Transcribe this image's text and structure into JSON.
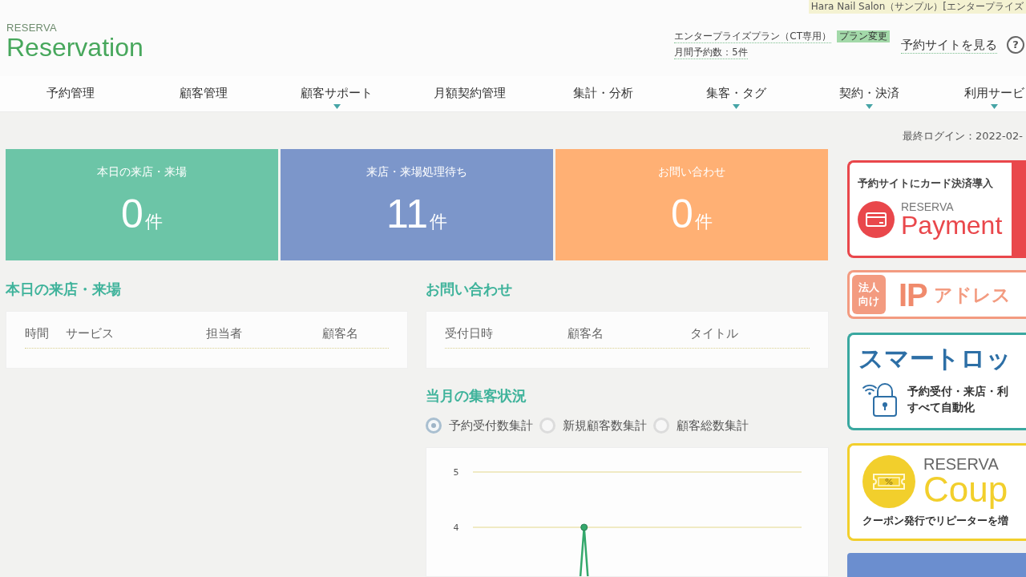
{
  "account_bar": {
    "label": "Hara Nail Salon（サンプル）[エンタープライズ"
  },
  "header": {
    "logo_small": "RESERVA",
    "logo": "Reservation",
    "plan": "エンタープライズプラン（CT専用）",
    "plan_change": "プラン変更",
    "monthly_count": "月間予約数：5件",
    "site_link": "予約サイトを見る",
    "help": "?"
  },
  "nav": [
    {
      "label": "予約管理",
      "has_submenu": false
    },
    {
      "label": "顧客管理",
      "has_submenu": false
    },
    {
      "label": "顧客サポート",
      "has_submenu": true
    },
    {
      "label": "月額契約管理",
      "has_submenu": false
    },
    {
      "label": "集計・分析",
      "has_submenu": false
    },
    {
      "label": "集客・タグ",
      "has_submenu": true
    },
    {
      "label": "契約・決済",
      "has_submenu": true
    },
    {
      "label": "利用サービ",
      "has_submenu": true
    }
  ],
  "last_login": "最終ログイン：2022-02-",
  "stats": [
    {
      "title": "本日の来店・来場",
      "count": "0",
      "unit": "件",
      "color": "#6cc5a7"
    },
    {
      "title": "来店・来場処理待ち",
      "count": "11",
      "unit": "件",
      "color": "#7c96ca"
    },
    {
      "title": "お問い合わせ",
      "count": "0",
      "unit": "件",
      "color": "#ffb074"
    }
  ],
  "today_visits": {
    "title": "本日の来店・来場",
    "columns": [
      "時間",
      "サービス",
      "担当者",
      "顧客名"
    ]
  },
  "inquiries": {
    "title": "お問い合わせ",
    "columns": [
      "受付日時",
      "顧客名",
      "タイトル"
    ]
  },
  "monthly_status": {
    "title": "当月の集客状況",
    "options": [
      {
        "label": "予約受付数集計",
        "selected": true
      },
      {
        "label": "新規顧客数集計",
        "selected": false
      },
      {
        "label": "顧客総数集計",
        "selected": false
      }
    ],
    "chart": {
      "axis_labels": [
        "5",
        "4"
      ]
    }
  },
  "banners": [
    {
      "kind": "payment",
      "headline": "予約サイトにカード決済導入",
      "brand": "RESERVA",
      "product": "Payment"
    },
    {
      "kind": "ip",
      "tag": "法人向け",
      "big": "IP",
      "title": "アドレス"
    },
    {
      "kind": "smartlock",
      "title": "スマートロッ",
      "lines": [
        "予約受付・来店・利",
        "すべて自動化"
      ]
    },
    {
      "kind": "coupon",
      "brand": "RESERVA",
      "product": "Coup",
      "caption": "クーポン発行でリピーターを増"
    },
    {
      "kind": "image"
    }
  ]
}
